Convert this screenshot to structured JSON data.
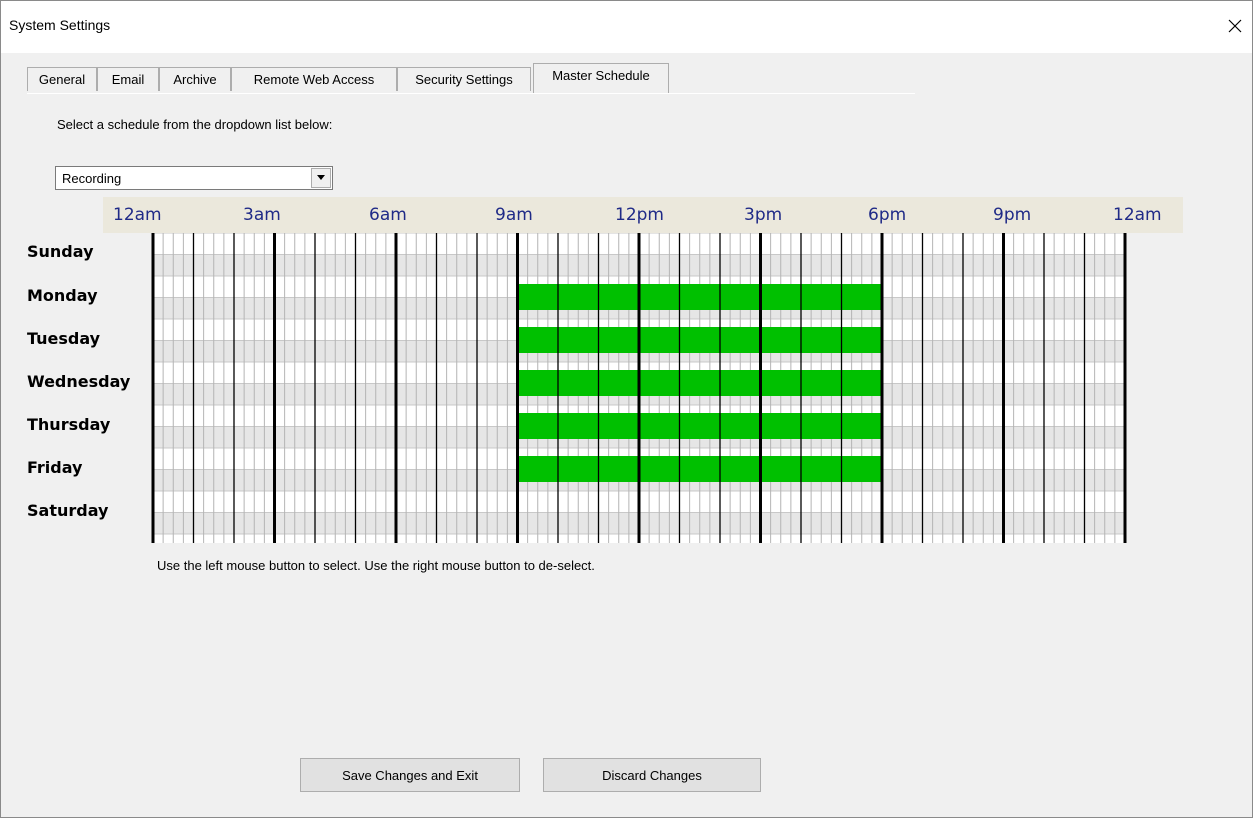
{
  "window": {
    "title": "System Settings"
  },
  "tabs": [
    {
      "label": "General"
    },
    {
      "label": "Email"
    },
    {
      "label": "Archive"
    },
    {
      "label": "Remote Web Access"
    },
    {
      "label": "Security Settings"
    },
    {
      "label": "Master Schedule"
    }
  ],
  "active_tab": "Master Schedule",
  "instruction": "Select a schedule from the dropdown list below:",
  "schedule_select": {
    "value": "Recording"
  },
  "time_labels": [
    "12am",
    "3am",
    "6am",
    "9am",
    "12pm",
    "3pm",
    "6pm",
    "9pm",
    "12am"
  ],
  "days": [
    {
      "label": "Sunday",
      "selected_hours": null
    },
    {
      "label": "Monday",
      "selected_hours": [
        9,
        18
      ]
    },
    {
      "label": "Tuesday",
      "selected_hours": [
        9,
        18
      ]
    },
    {
      "label": "Wednesday",
      "selected_hours": [
        9,
        18
      ]
    },
    {
      "label": "Thursday",
      "selected_hours": [
        9,
        18
      ]
    },
    {
      "label": "Friday",
      "selected_hours": [
        9,
        18
      ]
    },
    {
      "label": "Saturday",
      "selected_hours": null
    }
  ],
  "hint": "Use the left mouse button to select. Use the right mouse button to de-select.",
  "buttons": {
    "save": "Save Changes and Exit",
    "discard": "Discard Changes"
  },
  "colors": {
    "selected": "#00c000",
    "time_label": "#1f2a87",
    "header_bg": "#ebe8dc"
  }
}
